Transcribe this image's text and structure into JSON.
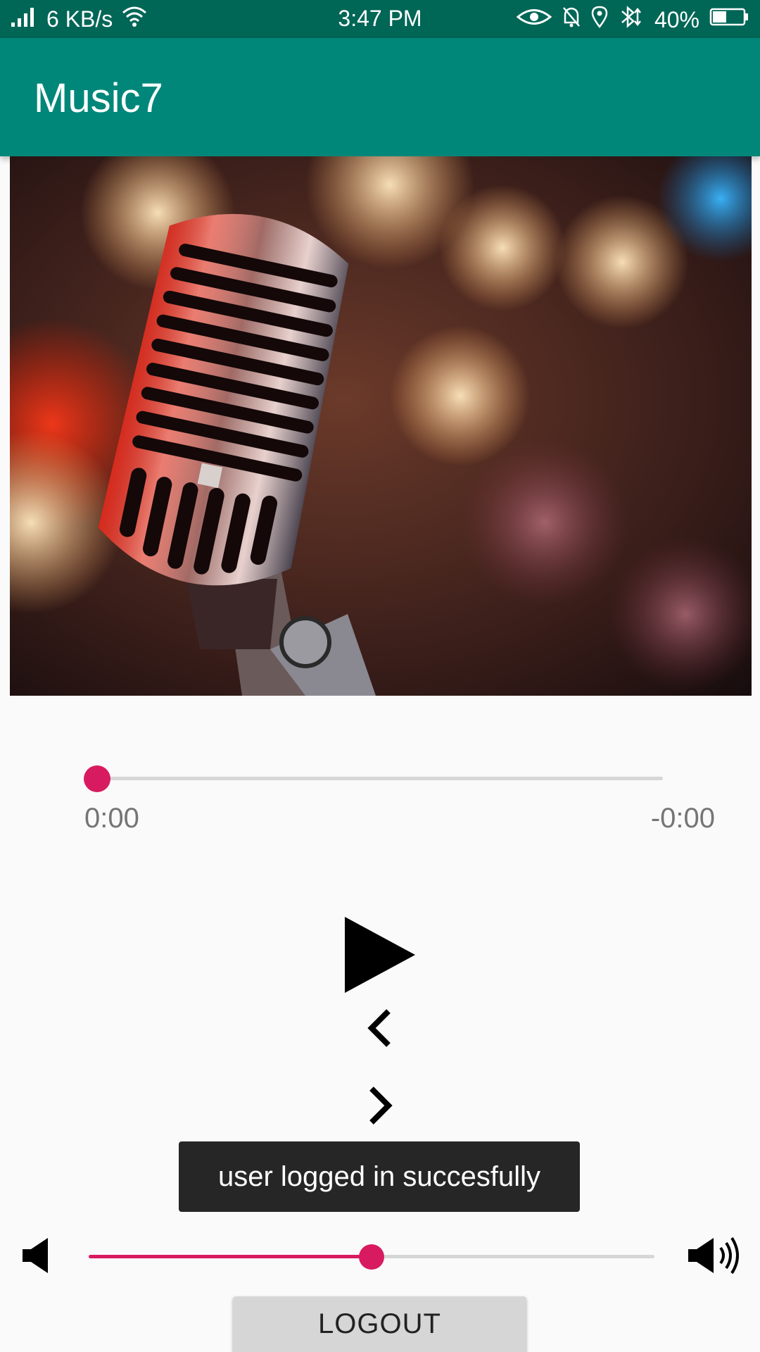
{
  "status_bar": {
    "net_speed": "6 KB/s",
    "time": "3:47 PM",
    "battery": "40%",
    "icons": [
      "signal-icon",
      "wifi-icon",
      "eye-icon",
      "bell-off-icon",
      "location-icon",
      "bluetooth-icon",
      "battery-icon"
    ]
  },
  "app_bar": {
    "title": "Music7"
  },
  "player": {
    "current_time": "0:00",
    "remaining_time": "-0:00",
    "progress": 0,
    "volume": 0.5
  },
  "toast": {
    "message": "user logged in succesfully"
  },
  "logout": {
    "label": "LOGOUT"
  },
  "colors": {
    "status_bar": "#006656",
    "app_bar": "#00877a",
    "accent": "#d81b60"
  }
}
